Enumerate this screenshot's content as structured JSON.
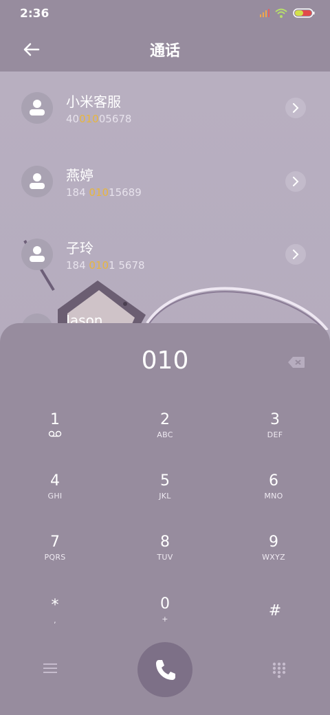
{
  "status_bar": {
    "time": "2:36",
    "icons": [
      "signal-icon",
      "wifi-icon",
      "battery-icon"
    ]
  },
  "header": {
    "title": "通话",
    "back_icon": "back-arrow-icon"
  },
  "contacts": [
    {
      "name": "小米客服",
      "number_pre": "40",
      "number_hl": "010",
      "number_post": "05678"
    },
    {
      "name": "燕婷",
      "number_pre": "184 ",
      "number_hl": "010",
      "number_post": "15689"
    },
    {
      "name": "子玲",
      "number_pre": "184 ",
      "number_hl": "010",
      "number_post": "1 5678"
    }
  ],
  "partial_contact": {
    "name": "Jason"
  },
  "dialer": {
    "entered_number": "010",
    "keys": [
      {
        "digit": "1",
        "letters": ""
      },
      {
        "digit": "2",
        "letters": "ABC"
      },
      {
        "digit": "3",
        "letters": "DEF"
      },
      {
        "digit": "4",
        "letters": "GHI"
      },
      {
        "digit": "5",
        "letters": "JKL"
      },
      {
        "digit": "6",
        "letters": "MNO"
      },
      {
        "digit": "7",
        "letters": "PQRS"
      },
      {
        "digit": "8",
        "letters": "TUV"
      },
      {
        "digit": "9",
        "letters": "WXYZ"
      },
      {
        "digit": "*",
        "letters": ","
      },
      {
        "digit": "0",
        "letters": "+"
      },
      {
        "digit": "#",
        "letters": ""
      }
    ]
  },
  "colors": {
    "accent_highlight": "#e8b63e",
    "sheet": "#978c9e",
    "call_button": "#7d7087"
  }
}
